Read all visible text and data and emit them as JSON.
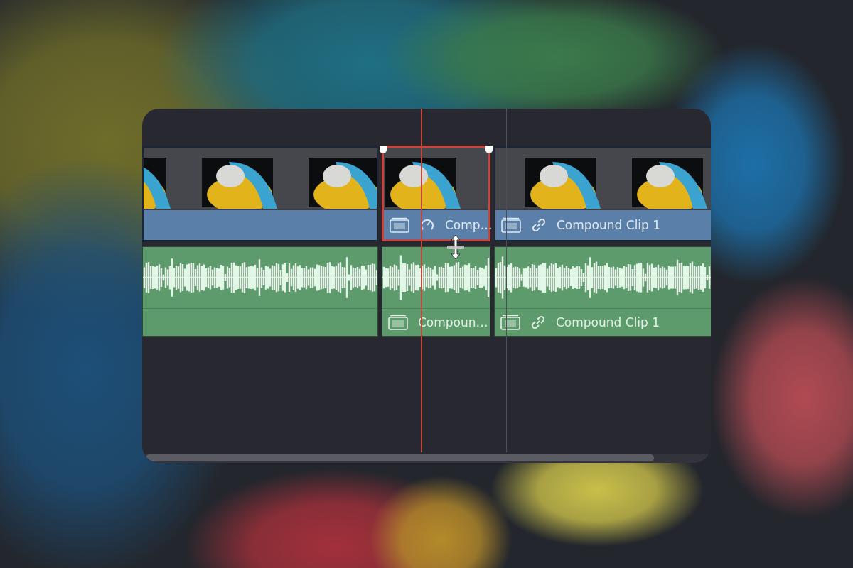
{
  "video_track": {
    "clips": [
      {
        "selected": false,
        "compound": false,
        "speed_change": false,
        "linked": false
      },
      {
        "selected": true,
        "compound": true,
        "speed_change": true,
        "linked": false,
        "label": "Comp…"
      },
      {
        "selected": false,
        "compound": true,
        "speed_change": false,
        "linked": true,
        "label": "Compound Clip 1"
      }
    ]
  },
  "audio_track": {
    "clips": [
      {
        "selected": false,
        "compound": false,
        "speed_change": false,
        "linked": false
      },
      {
        "selected": false,
        "compound": true,
        "speed_change": false,
        "linked": false,
        "label": "Compoun…"
      },
      {
        "selected": false,
        "compound": true,
        "speed_change": false,
        "linked": true,
        "label": "Compound Clip 1"
      }
    ]
  }
}
